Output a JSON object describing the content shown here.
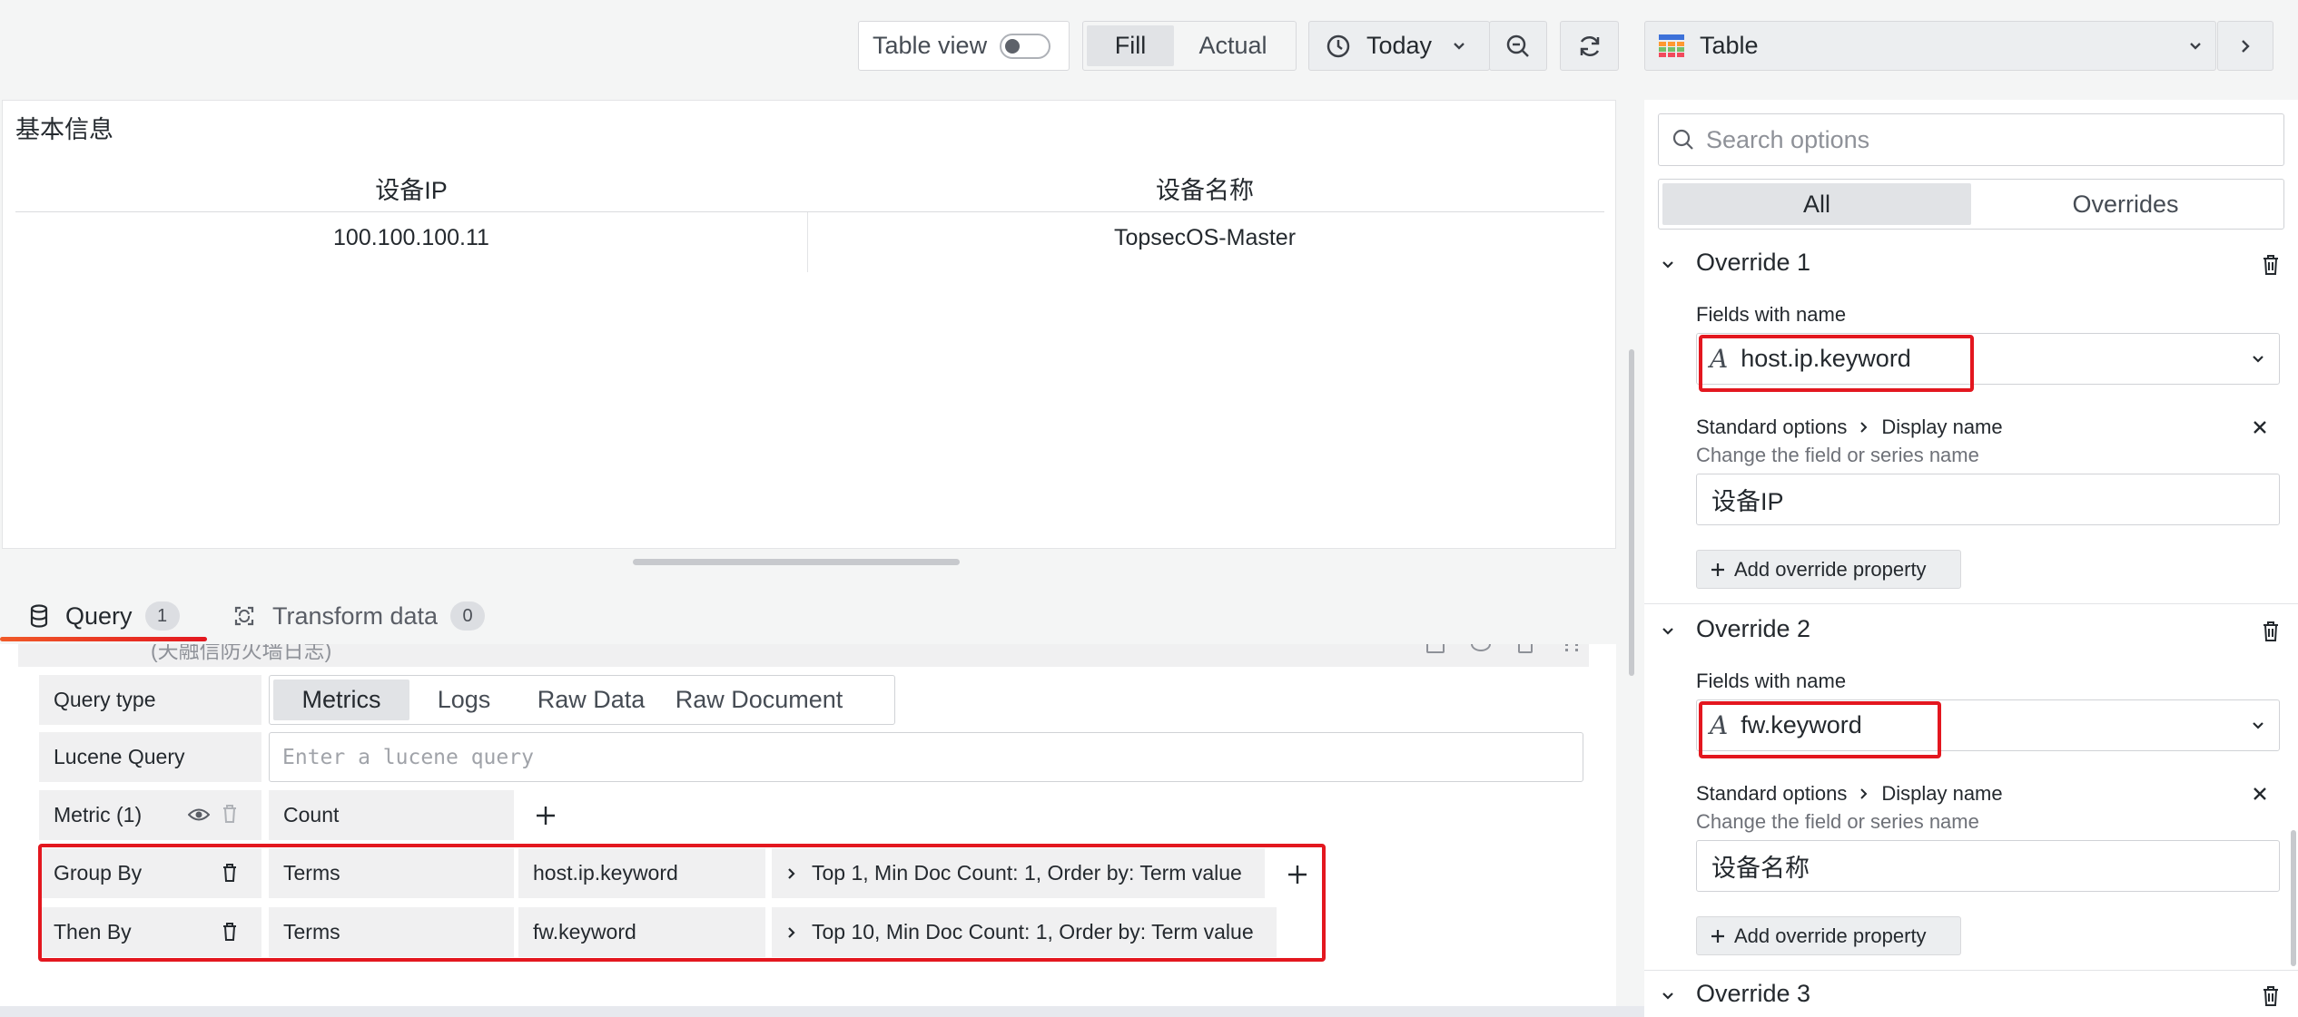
{
  "toolbar": {
    "table_view_label": "Table view",
    "fill_label": "Fill",
    "actual_label": "Actual",
    "time_label": "Today",
    "viz_label": "Table"
  },
  "panel": {
    "title": "基本信息",
    "columns": [
      "设备IP",
      "设备名称"
    ],
    "rows": [
      [
        "100.100.100.11",
        "TopsecOS-Master"
      ]
    ]
  },
  "tabs": {
    "query_label": "Query",
    "query_count": "1",
    "transform_label": "Transform data",
    "transform_count": "0"
  },
  "query": {
    "truncated_title": "(天融信防火墙日志)",
    "query_type_label": "Query type",
    "query_types": [
      "Metrics",
      "Logs",
      "Raw Data",
      "Raw Document"
    ],
    "lucene_label": "Lucene Query",
    "lucene_placeholder": "Enter a lucene query",
    "metric_label": "Metric (1)",
    "metric_value": "Count",
    "group_by_label": "Group By",
    "group_by_type": "Terms",
    "group_by_field": "host.ip.keyword",
    "group_by_options": "Top 1, Min Doc Count: 1, Order by: Term value",
    "then_by_label": "Then By",
    "then_by_type": "Terms",
    "then_by_field": "fw.keyword",
    "then_by_options": "Top 10, Min Doc Count: 1, Order by: Term value"
  },
  "options": {
    "search_placeholder": "Search options",
    "tab_all": "All",
    "tab_overrides": "Overrides",
    "overrides": [
      {
        "title": "Override 1",
        "fields_label": "Fields with name",
        "field_name": "host.ip.keyword",
        "property_path_1": "Standard options",
        "property_path_2": "Display name",
        "property_desc": "Change the field or series name",
        "property_value": "设备IP",
        "add_label": "Add override property"
      },
      {
        "title": "Override 2",
        "fields_label": "Fields with name",
        "field_name": "fw.keyword",
        "property_path_1": "Standard options",
        "property_path_2": "Display name",
        "property_desc": "Change the field or series name",
        "property_value": "设备名称",
        "add_label": "Add override property"
      },
      {
        "title": "Override 3"
      }
    ]
  },
  "colors": {
    "accent": "#3d71d9",
    "highlight": "#e3171f",
    "tab_underline": "#f05a28"
  }
}
